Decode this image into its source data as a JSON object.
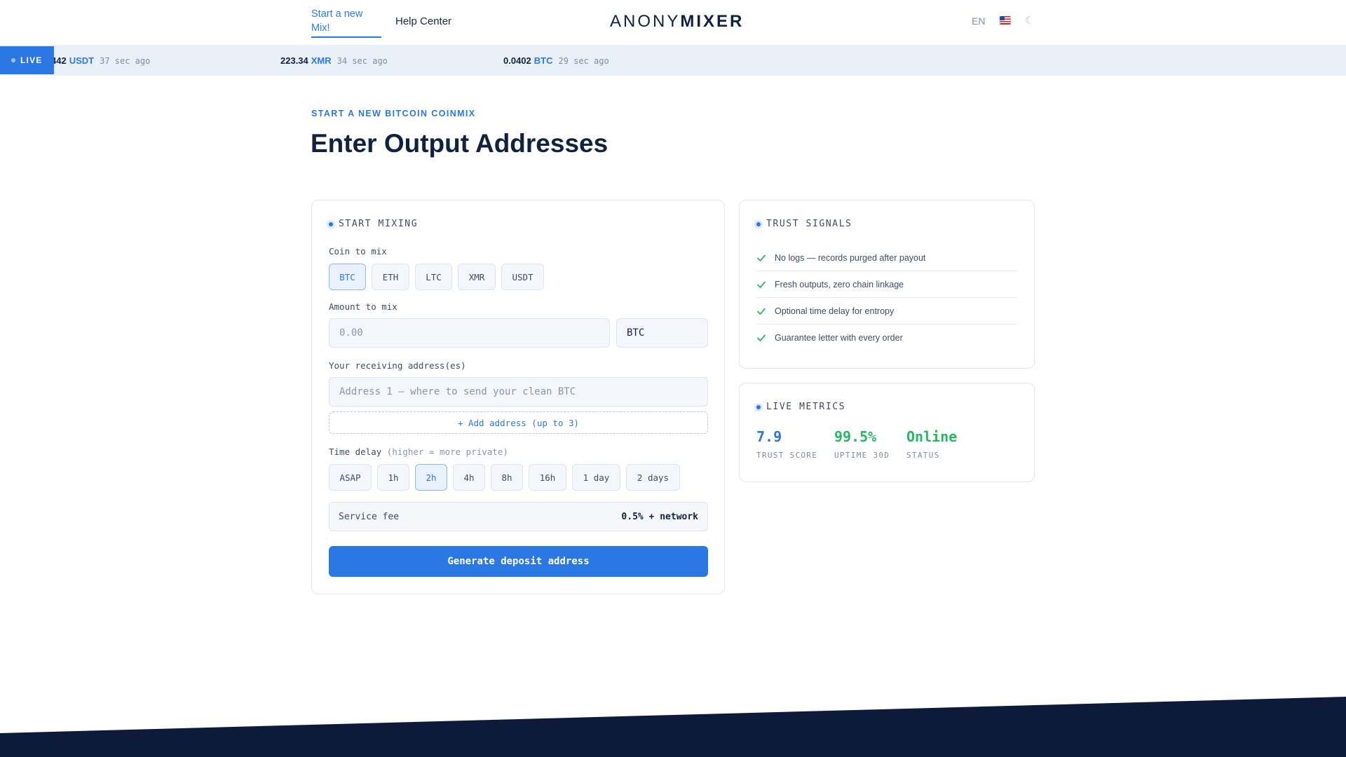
{
  "header": {
    "nav": [
      {
        "label": "Start a new Mix!",
        "active": true
      },
      {
        "label": "Help Center",
        "active": false
      }
    ],
    "logo_light": "ANONY",
    "logo_bold": "MIXER",
    "language": "EN",
    "flag_icon": "us-flag-icon",
    "theme_icon": "moon-icon"
  },
  "ticker": {
    "badge": "LIVE",
    "items": [
      {
        "amount": "442",
        "coin": "USDT",
        "ago": "37 sec ago"
      },
      {
        "amount": "223.34",
        "coin": "XMR",
        "ago": "34 sec ago"
      },
      {
        "amount": "0.0402",
        "coin": "BTC",
        "ago": "29 sec ago"
      }
    ]
  },
  "page": {
    "eyebrow": "START A NEW BITCOIN COINMIX",
    "title": "Enter Output Addresses"
  },
  "mix_card": {
    "title": "START MIXING",
    "coin_label": "Coin to mix",
    "coins": [
      "BTC",
      "ETH",
      "LTC",
      "XMR",
      "USDT"
    ],
    "selected_coin": "BTC",
    "amount_label": "Amount to mix",
    "amount_placeholder": "0.00",
    "amount_unit": "BTC",
    "address_label": "Your receiving address(es)",
    "address_placeholder": "Address 1 — where to send your clean BTC",
    "add_address": "+ Add address (up to 3)",
    "delay_label": "Time delay",
    "delay_hint": "(higher = more private)",
    "delays": [
      "ASAP",
      "1h",
      "2h",
      "4h",
      "8h",
      "16h",
      "1 day",
      "2 days"
    ],
    "selected_delay": "2h",
    "fee_label": "Service fee",
    "fee_value": "0.5% + network",
    "submit": "Generate deposit address"
  },
  "trust_card": {
    "title": "TRUST SIGNALS",
    "items": [
      "No logs — records purged after payout",
      "Fresh outputs, zero chain linkage",
      "Optional time delay for entropy",
      "Guarantee letter with every order"
    ]
  },
  "metrics_card": {
    "title": "LIVE METRICS",
    "metrics": [
      {
        "value": "7.9",
        "label": "TRUST SCORE"
      },
      {
        "value": "99.5%",
        "label": "UPTIME 30D"
      },
      {
        "value": "Online",
        "label": "STATUS"
      }
    ]
  },
  "colors": {
    "accent": "#2b78e4",
    "success": "#27b865",
    "text": "#0f2240",
    "footer": "#0d1a3a"
  }
}
